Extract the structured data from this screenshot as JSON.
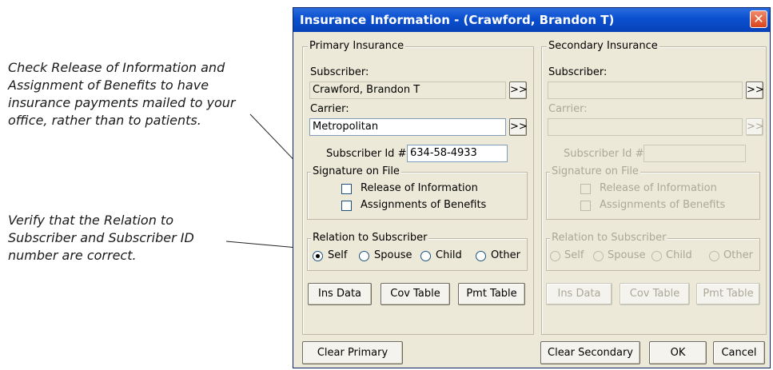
{
  "annotations": {
    "note1": "Check Release of Information and\nAssignment of Benefits to have\ninsurance payments mailed to your\noffice, rather than to patients.",
    "note2": "Verify that the Relation to\nSubscriber and Subscriber ID\nnumber are correct."
  },
  "window": {
    "title": "Insurance Information - (Crawford, Brandon T)",
    "close_glyph": "✕"
  },
  "primary": {
    "group_label": "Primary Insurance",
    "subscriber_label": "Subscriber:",
    "subscriber_value": "Crawford, Brandon T",
    "carrier_label": "Carrier:",
    "carrier_value": "Metropolitan",
    "browse_glyph": ">>",
    "subscriber_id_label": "Subscriber Id #:",
    "subscriber_id_value": "634-58-4933",
    "signature_label": "Signature on File",
    "release_label": "Release of Information",
    "assign_label": "Assignments of Benefits",
    "relation_label": "Relation to Subscriber",
    "relations": [
      "Self",
      "Spouse",
      "Child",
      "Other"
    ],
    "selected_relation": "Self",
    "buttons": [
      "Ins Data",
      "Cov Table",
      "Pmt Table"
    ]
  },
  "secondary": {
    "group_label": "Secondary Insurance",
    "subscriber_label": "Subscriber:",
    "subscriber_value": "",
    "carrier_label": "Carrier:",
    "carrier_value": "",
    "browse_glyph": ">>",
    "subscriber_id_label": "Subscriber Id #:",
    "subscriber_id_value": "",
    "signature_label": "Signature on File",
    "release_label": "Release of Information",
    "assign_label": "Assignments of Benefits",
    "relation_label": "Relation to Subscriber",
    "relations": [
      "Self",
      "Spouse",
      "Child",
      "Other"
    ],
    "buttons": [
      "Ins Data",
      "Cov Table",
      "Pmt Table"
    ]
  },
  "footer": {
    "clear_primary": "Clear Primary",
    "clear_secondary": "Clear Secondary",
    "ok": "OK",
    "cancel": "Cancel"
  }
}
